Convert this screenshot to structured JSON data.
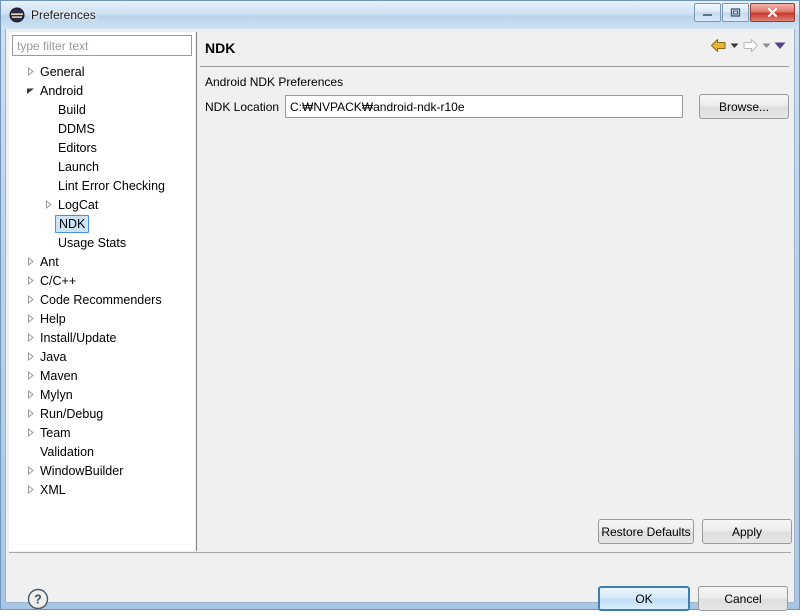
{
  "window": {
    "title": "Preferences",
    "icon": "eclipse-logo-icon",
    "controls": {
      "minimize": "minimize-icon",
      "restore": "restore-icon",
      "close": "close-icon"
    }
  },
  "sidebar": {
    "filter": {
      "value": "",
      "placeholder": "type filter text"
    },
    "items": [
      {
        "label": "General",
        "indent": 0,
        "arrow": "collapsed",
        "selected": false
      },
      {
        "label": "Android",
        "indent": 0,
        "arrow": "expanded",
        "selected": false
      },
      {
        "label": "Build",
        "indent": 1,
        "arrow": "none",
        "selected": false
      },
      {
        "label": "DDMS",
        "indent": 1,
        "arrow": "none",
        "selected": false
      },
      {
        "label": "Editors",
        "indent": 1,
        "arrow": "none",
        "selected": false
      },
      {
        "label": "Launch",
        "indent": 1,
        "arrow": "none",
        "selected": false
      },
      {
        "label": "Lint Error Checking",
        "indent": 1,
        "arrow": "none",
        "selected": false
      },
      {
        "label": "LogCat",
        "indent": 1,
        "arrow": "collapsed",
        "selected": false
      },
      {
        "label": "NDK",
        "indent": 1,
        "arrow": "none",
        "selected": true
      },
      {
        "label": "Usage Stats",
        "indent": 1,
        "arrow": "none",
        "selected": false
      },
      {
        "label": "Ant",
        "indent": 0,
        "arrow": "collapsed",
        "selected": false
      },
      {
        "label": "C/C++",
        "indent": 0,
        "arrow": "collapsed",
        "selected": false
      },
      {
        "label": "Code Recommenders",
        "indent": 0,
        "arrow": "collapsed",
        "selected": false
      },
      {
        "label": "Help",
        "indent": 0,
        "arrow": "collapsed",
        "selected": false
      },
      {
        "label": "Install/Update",
        "indent": 0,
        "arrow": "collapsed",
        "selected": false
      },
      {
        "label": "Java",
        "indent": 0,
        "arrow": "collapsed",
        "selected": false
      },
      {
        "label": "Maven",
        "indent": 0,
        "arrow": "collapsed",
        "selected": false
      },
      {
        "label": "Mylyn",
        "indent": 0,
        "arrow": "collapsed",
        "selected": false
      },
      {
        "label": "Run/Debug",
        "indent": 0,
        "arrow": "collapsed",
        "selected": false
      },
      {
        "label": "Team",
        "indent": 0,
        "arrow": "collapsed",
        "selected": false
      },
      {
        "label": "Validation",
        "indent": 0,
        "arrow": "none",
        "selected": false
      },
      {
        "label": "WindowBuilder",
        "indent": 0,
        "arrow": "collapsed",
        "selected": false
      },
      {
        "label": "XML",
        "indent": 0,
        "arrow": "collapsed",
        "selected": false
      }
    ]
  },
  "page": {
    "title": "NDK",
    "group_label": "Android NDK Preferences",
    "field_label": "NDK Location",
    "ndk_location": {
      "value": "C:₩NVPACK₩android-ndk-r10e",
      "placeholder": ""
    },
    "browse_label": "Browse...",
    "restore_label": "Restore Defaults",
    "apply_label": "Apply",
    "nav": {
      "back": "back-arrow-icon",
      "back_menu": "back-history-dropdown-icon",
      "forward": "forward-arrow-icon",
      "forward_menu": "forward-history-dropdown-icon",
      "menu": "view-menu-icon"
    }
  },
  "footer": {
    "help": "help-icon",
    "ok_label": "OK",
    "cancel_label": "Cancel"
  },
  "colors": {
    "titlebar_top": "#e9f2fb",
    "titlebar_bottom": "#cfe2f4",
    "window_border": "#6f95bd",
    "panel_bg": "#f0f0f0",
    "tree_bg": "#ffffff",
    "selection_fill": "#cde4f7",
    "selection_border": "#4a90d9",
    "default_button_border": "#3c7fb1",
    "close_button": "#c8392c",
    "back_arrow": "#e8b53a",
    "forward_arrow": "#b8b8b8",
    "menu_arrow": "#5b3f8f"
  }
}
